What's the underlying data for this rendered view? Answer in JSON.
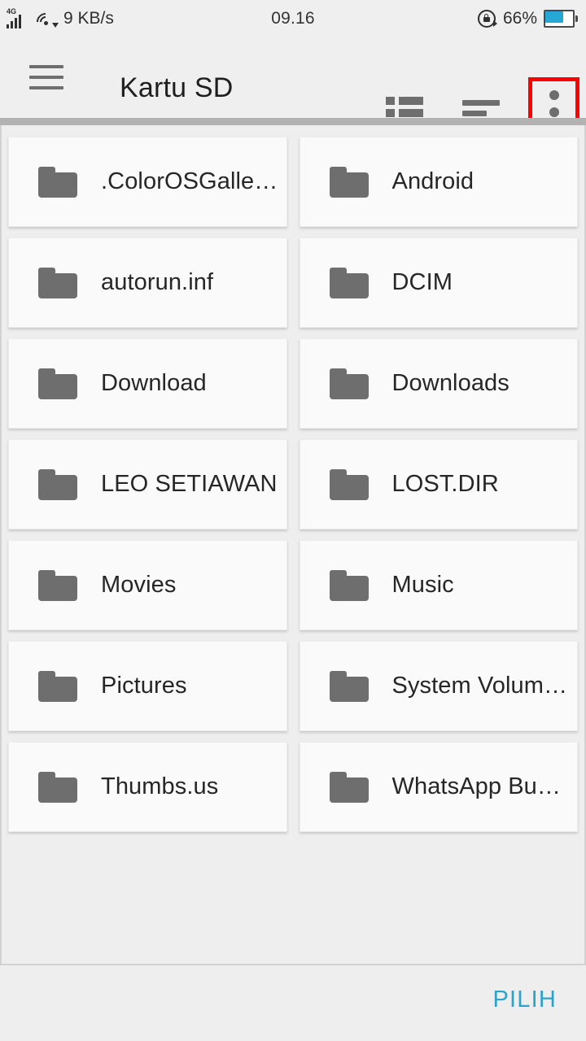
{
  "status_bar": {
    "network_type": "4G",
    "signal_icon": "signal-bars-icon",
    "wifi_icon": "wifi-download-icon",
    "data_rate": "9 KB/s",
    "time": "09.16",
    "rotation_lock_icon": "rotation-lock-icon",
    "battery_percent": "66%",
    "battery_level": 66,
    "battery_fill_color": "#25a8d4"
  },
  "app_bar": {
    "menu_icon": "hamburger-menu-icon",
    "title": "Kartu SD",
    "actions": [
      {
        "name": "list-view-icon",
        "label": "List view"
      },
      {
        "name": "sort-icon",
        "label": "Sort"
      },
      {
        "name": "overflow-menu-icon",
        "label": "More options"
      }
    ],
    "highlight_color": "#ff0000"
  },
  "file_grid": {
    "items": [
      {
        "label": ".ColorOSGalle…",
        "icon": "folder-icon"
      },
      {
        "label": "Android",
        "icon": "folder-icon"
      },
      {
        "label": "autorun.inf",
        "icon": "folder-icon"
      },
      {
        "label": "DCIM",
        "icon": "folder-icon"
      },
      {
        "label": "Download",
        "icon": "folder-icon"
      },
      {
        "label": "Downloads",
        "icon": "folder-icon"
      },
      {
        "label": "LEO SETIAWAN",
        "icon": "folder-icon"
      },
      {
        "label": "LOST.DIR",
        "icon": "folder-icon"
      },
      {
        "label": "Movies",
        "icon": "folder-icon"
      },
      {
        "label": "Music",
        "icon": "folder-icon"
      },
      {
        "label": "Pictures",
        "icon": "folder-icon"
      },
      {
        "label": "System Volum…",
        "icon": "folder-icon"
      },
      {
        "label": "Thumbs.us",
        "icon": "folder-icon"
      },
      {
        "label": "WhatsApp Bu…",
        "icon": "folder-icon"
      }
    ]
  },
  "bottom_bar": {
    "select_label": "PILIH",
    "accent_color": "#2ba3cd"
  }
}
